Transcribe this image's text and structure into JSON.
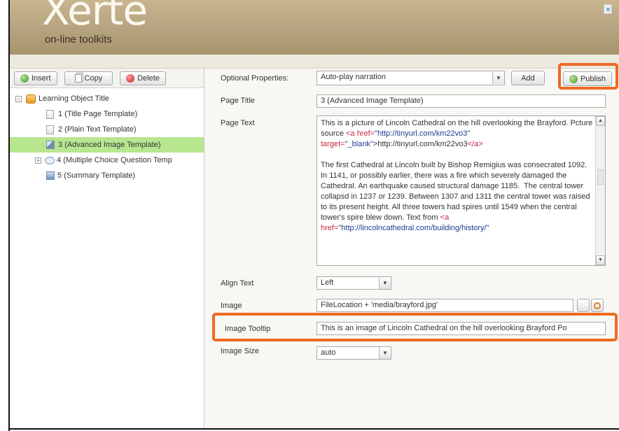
{
  "header": {
    "logo_text": "Xerte",
    "logo_subtitle": "on-line toolkits"
  },
  "toolbar": {
    "insert_label": "Insert",
    "copy_label": "Copy",
    "delete_label": "Delete"
  },
  "tree": {
    "root_label": "Learning Object Title",
    "items": [
      {
        "label": "1 (Title Page Template)",
        "icon": "document-icon",
        "selected": false
      },
      {
        "label": "2 (Plain Text Template)",
        "icon": "document-icon",
        "selected": false
      },
      {
        "label": "3 (Advanced Image Template)",
        "icon": "image-icon",
        "selected": true
      },
      {
        "label": "4 (Multiple Choice Question Temp",
        "icon": "speech-bubble-icon",
        "selected": false
      },
      {
        "label": "5 (Summary Template)",
        "icon": "summary-icon",
        "selected": false
      }
    ]
  },
  "optional_properties": {
    "label": "Optional Properties:",
    "selected": "Auto-play narration",
    "add_label": "Add",
    "publish_label": "Publish"
  },
  "form": {
    "page_title_label": "Page Title",
    "page_title_value": "3 (Advanced Image Template)",
    "page_text_label": "Page Text",
    "page_text": {
      "p1_a": "This is a picture of Lincoln Cathedral on the hill overlooking the Brayford. Pcture source ",
      "p1_tag_open": "<a ",
      "p1_attr1": "href=",
      "p1_val1": "\"http://tinyurl.com/km22vo3\"",
      "p1_attr2": "target=",
      "p1_val2": "\"_blank\"",
      "p1_link_text": ">http://tinyurl.com/km22vo3",
      "p1_tag_close": "</a>",
      "p2_a": "The first Cathedral at Lincoln built by Bishop Remigius was consecrated 1092. In 1141, or possibly earlier, there was a fire which severely damaged the Cathedral. An earthquake caused structural damage 1185.  The central tower collapsd in 1237 or 1239. Between 1307 and 1311 the central tower was raised to its present height. All three towers had spires until 1549 when the central tower's spire blew down. Text from ",
      "p2_tag_open": "<a ",
      "p2_attr1": "href=",
      "p2_val1": "\"http://lincolncathedral.com/building/history/\""
    },
    "align_text_label": "Align Text",
    "align_text_value": "Left",
    "image_label": "Image",
    "image_value": "FileLocation + 'media/brayford.jpg'",
    "image_tooltip_label": "Image Tooltip",
    "image_tooltip_value": "This is an image of Lincoln Cathedral on the hill overlooking Brayford Po",
    "image_size_label": "Image Size",
    "image_size_value": "auto"
  },
  "colors": {
    "highlight": "#ee6a22",
    "selected_row": "#b7e68f",
    "header": "#b5a37f"
  }
}
